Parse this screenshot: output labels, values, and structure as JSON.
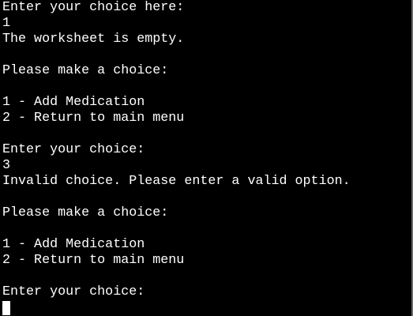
{
  "terminal": {
    "lines": [
      "Enter your choice here:",
      "1",
      "The worksheet is empty.",
      "",
      "Please make a choice:",
      "",
      "1 - Add Medication",
      "2 - Return to main menu",
      "",
      "Enter your choice:",
      "3",
      "Invalid choice. Please enter a valid option.",
      "",
      "Please make a choice:",
      "",
      "1 - Add Medication",
      "2 - Return to main menu",
      "",
      "Enter your choice:"
    ]
  },
  "colors": {
    "background": "#000000",
    "text": "#ffffff"
  }
}
